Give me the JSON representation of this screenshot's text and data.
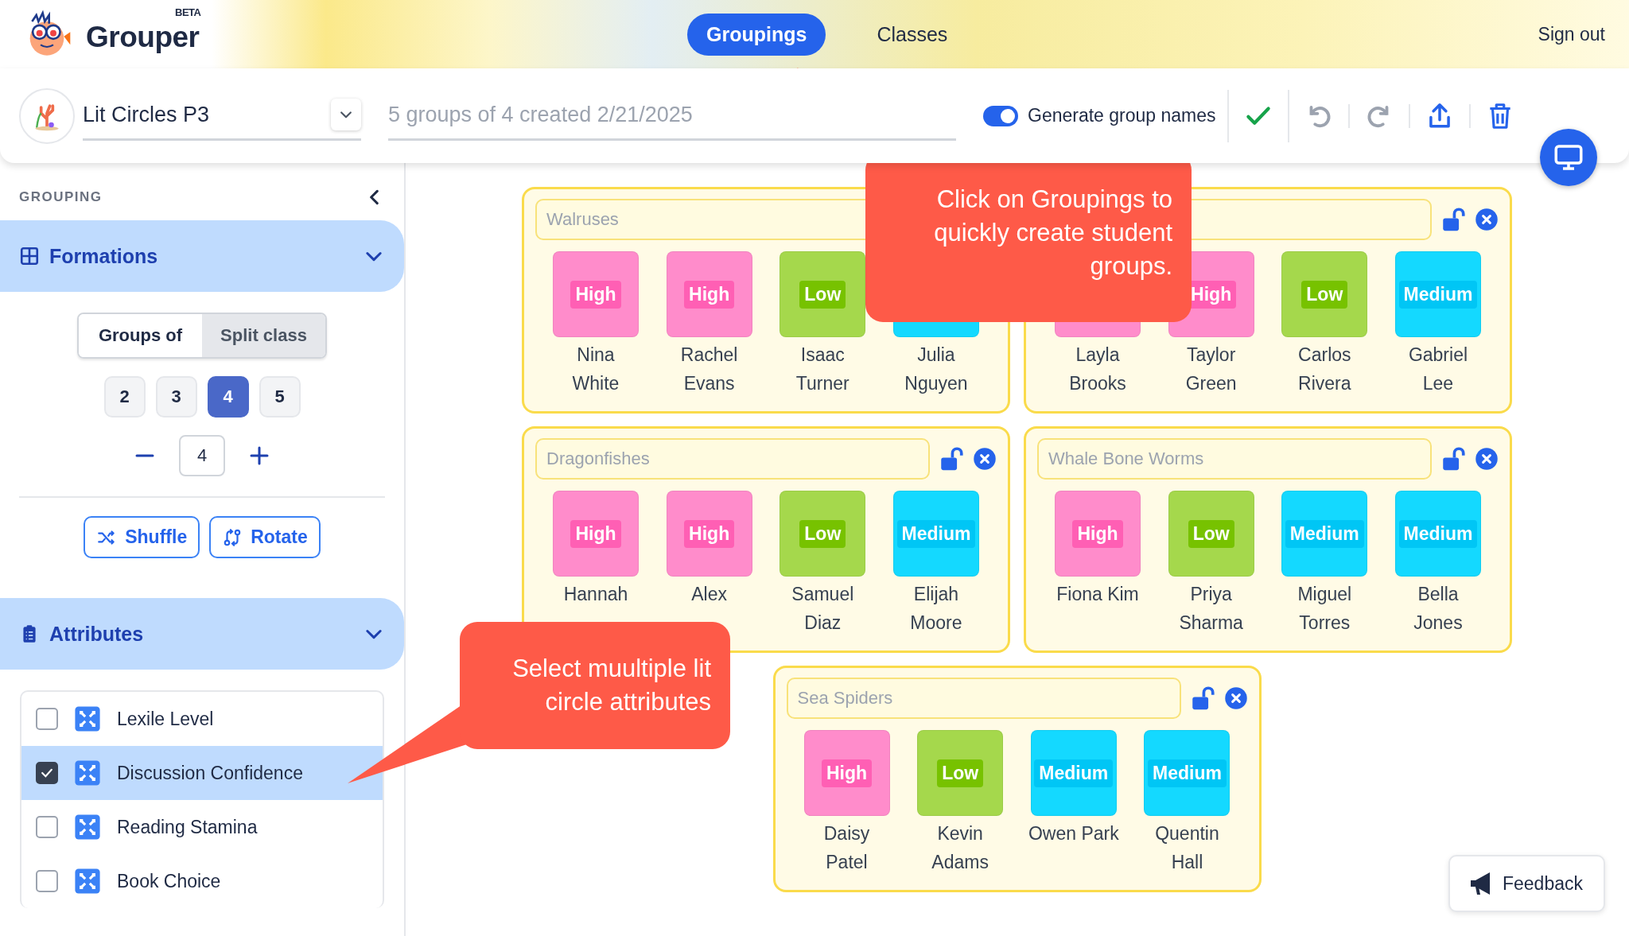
{
  "header": {
    "logo": {
      "name": "Grouper",
      "badge": "BETA"
    },
    "tabs": [
      {
        "label": "Groupings",
        "selected": true
      },
      {
        "label": "Classes",
        "selected": false
      }
    ],
    "sign_out": "Sign out"
  },
  "toolbar": {
    "grouping_name": "Lit Circles P3",
    "description": "5 groups of 4 created 2/21/2025",
    "generate_group_names": {
      "label": "Generate group names",
      "on": true
    }
  },
  "sidebar": {
    "heading": "GROUPING",
    "formations": {
      "title": "Formations",
      "expanded": true,
      "modes": [
        {
          "label": "Groups of",
          "selected": true
        },
        {
          "label": "Split class",
          "selected": false
        }
      ],
      "sizes": [
        {
          "label": "2",
          "selected": false
        },
        {
          "label": "3",
          "selected": false
        },
        {
          "label": "4",
          "selected": true
        },
        {
          "label": "5",
          "selected": false
        }
      ],
      "count": "4",
      "actions": [
        "Shuffle",
        "Rotate"
      ]
    },
    "attributes": {
      "title": "Attributes",
      "expanded": true,
      "items": [
        {
          "label": "Lexile Level",
          "checked": false,
          "selected": false
        },
        {
          "label": "Discussion Confidence",
          "checked": true,
          "selected": true
        },
        {
          "label": "Reading Stamina",
          "checked": false,
          "selected": false
        },
        {
          "label": "Book Choice",
          "checked": false,
          "selected": false
        }
      ]
    }
  },
  "groups": [
    {
      "name": "Walruses",
      "students": [
        {
          "name_lines": [
            "Nina",
            "White"
          ],
          "badge": "High",
          "kind": "high"
        },
        {
          "name_lines": [
            "Rachel",
            "Evans"
          ],
          "badge": "High",
          "kind": "high"
        },
        {
          "name_lines": [
            "Isaac",
            "Turner"
          ],
          "badge": "Low",
          "kind": "low"
        },
        {
          "name_lines": [
            "Julia",
            "Nguyen"
          ],
          "kind": "medium"
        }
      ]
    },
    {
      "students": [
        {
          "name_lines": [
            "Layla",
            "Brooks"
          ],
          "kind": "high"
        },
        {
          "name_lines": [
            "Taylor",
            "Green"
          ],
          "badge": "High",
          "kind": "high"
        },
        {
          "name_lines": [
            "Carlos",
            "Rivera"
          ],
          "badge": "Low",
          "kind": "low"
        },
        {
          "name_lines": [
            "Gabriel",
            "Lee"
          ],
          "badge": "Medium",
          "kind": "medium"
        }
      ]
    },
    {
      "name": "Dragonfishes",
      "students": [
        {
          "name_lines": [
            "Hannah"
          ],
          "badge": "High",
          "kind": "high"
        },
        {
          "name_lines": [
            "Alex"
          ],
          "badge": "High",
          "kind": "high"
        },
        {
          "name_lines": [
            "Samuel",
            "Diaz"
          ],
          "badge": "Low",
          "kind": "low"
        },
        {
          "name_lines": [
            "Elijah",
            "Moore"
          ],
          "badge": "Medium",
          "kind": "medium"
        }
      ]
    },
    {
      "name": "Whale Bone Worms",
      "students": [
        {
          "name_lines": [
            "Fiona Kim"
          ],
          "badge": "High",
          "kind": "high"
        },
        {
          "name_lines": [
            "Priya",
            "Sharma"
          ],
          "badge": "Low",
          "kind": "low"
        },
        {
          "name_lines": [
            "Miguel",
            "Torres"
          ],
          "badge": "Medium",
          "kind": "medium"
        },
        {
          "name_lines": [
            "Bella",
            "Jones"
          ],
          "badge": "Medium",
          "kind": "medium"
        }
      ]
    },
    {
      "name": "Sea Spiders",
      "students": [
        {
          "name_lines": [
            "Daisy",
            "Patel"
          ],
          "badge": "High",
          "kind": "high"
        },
        {
          "name_lines": [
            "Kevin",
            "Adams"
          ],
          "badge": "Low",
          "kind": "low"
        },
        {
          "name_lines": [
            "Owen Park"
          ],
          "badge": "Medium",
          "kind": "medium"
        },
        {
          "name_lines": [
            "Quentin",
            "Hall"
          ],
          "badge": "Medium",
          "kind": "medium"
        }
      ]
    }
  ],
  "callouts": [
    "Click on Groupings to quickly create student groups.",
    "Select muultiple lit circle attributes"
  ],
  "feedback": "Feedback"
}
